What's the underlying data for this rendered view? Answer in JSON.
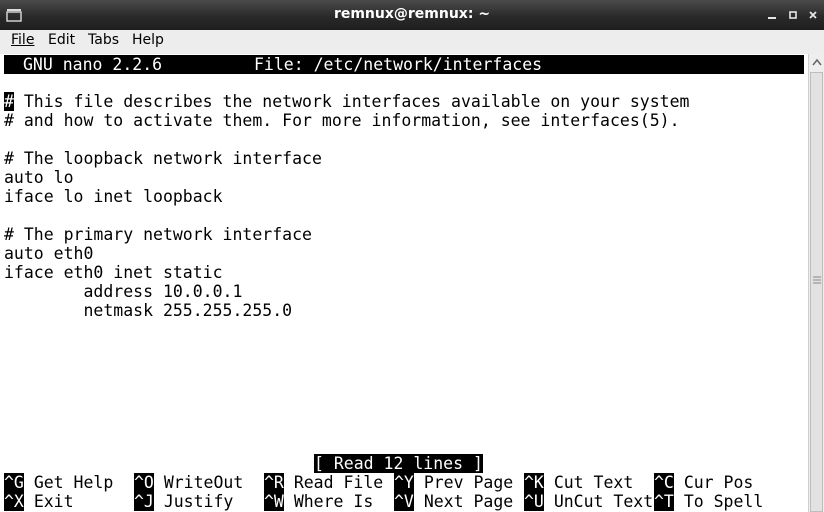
{
  "window": {
    "title": "remnux@remnux: ~"
  },
  "menu": {
    "items": [
      {
        "label": "File"
      },
      {
        "label": "Edit"
      },
      {
        "label": "Tabs"
      },
      {
        "label": "Help"
      }
    ]
  },
  "nano": {
    "version": "GNU nano 2.2.6",
    "file_label": "File: /etc/network/interfaces",
    "lines": [
      " This file describes the network interfaces available on your system",
      "# and how to activate them. For more information, see interfaces(5).",
      "",
      "# The loopback network interface",
      "auto lo",
      "iface lo inet loopback",
      "",
      "# The primary network interface",
      "auto eth0",
      "iface eth0 inet static",
      "        address 10.0.0.1",
      "        netmask 255.255.255.0"
    ],
    "cursor_char": "#",
    "status_message": "[ Read 12 lines ]",
    "shortcuts_row1": [
      {
        "key": "^G",
        "label": "Get Help"
      },
      {
        "key": "^O",
        "label": "WriteOut"
      },
      {
        "key": "^R",
        "label": "Read File"
      },
      {
        "key": "^Y",
        "label": "Prev Page"
      },
      {
        "key": "^K",
        "label": "Cut Text"
      },
      {
        "key": "^C",
        "label": "Cur Pos"
      }
    ],
    "shortcuts_row2": [
      {
        "key": "^X",
        "label": "Exit"
      },
      {
        "key": "^J",
        "label": "Justify"
      },
      {
        "key": "^W",
        "label": "Where Is"
      },
      {
        "key": "^V",
        "label": "Next Page"
      },
      {
        "key": "^U",
        "label": "UnCut Text"
      },
      {
        "key": "^T",
        "label": "To Spell"
      }
    ]
  },
  "icons": {
    "window": "terminal-window-icon",
    "minimize": "minimize-icon",
    "maximize": "maximize-icon",
    "close": "close-icon"
  }
}
